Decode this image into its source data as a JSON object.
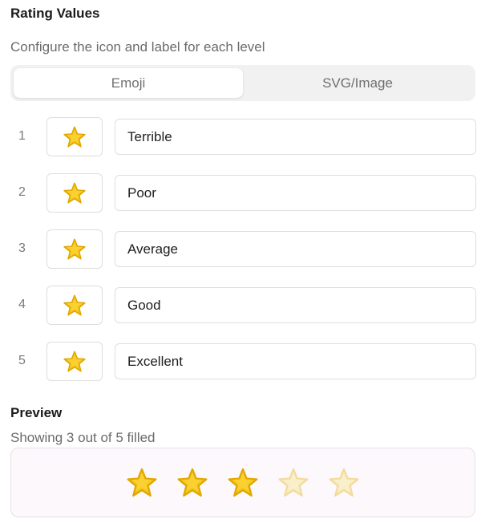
{
  "header": {
    "title": "Rating Values",
    "subtitle": "Configure the icon and label for each level"
  },
  "mode_tabs": [
    {
      "label": "Emoji",
      "active": true
    },
    {
      "label": "SVG/Image",
      "active": false
    }
  ],
  "levels": [
    {
      "number": "1",
      "icon": "star-icon",
      "label": "Terrible"
    },
    {
      "number": "2",
      "icon": "star-icon",
      "label": "Poor"
    },
    {
      "number": "3",
      "icon": "star-icon",
      "label": "Average"
    },
    {
      "number": "4",
      "icon": "star-icon",
      "label": "Good"
    },
    {
      "number": "5",
      "icon": "star-icon",
      "label": "Excellent"
    }
  ],
  "preview": {
    "title": "Preview",
    "status": "Showing 3 out of 5 filled",
    "filled": 3,
    "total": 5
  },
  "colors": {
    "star_fill": "#f5c518",
    "star_edge": "#e0a800",
    "star_empty": "#f9ebc0",
    "preview_bg": "#fdf8fc"
  }
}
